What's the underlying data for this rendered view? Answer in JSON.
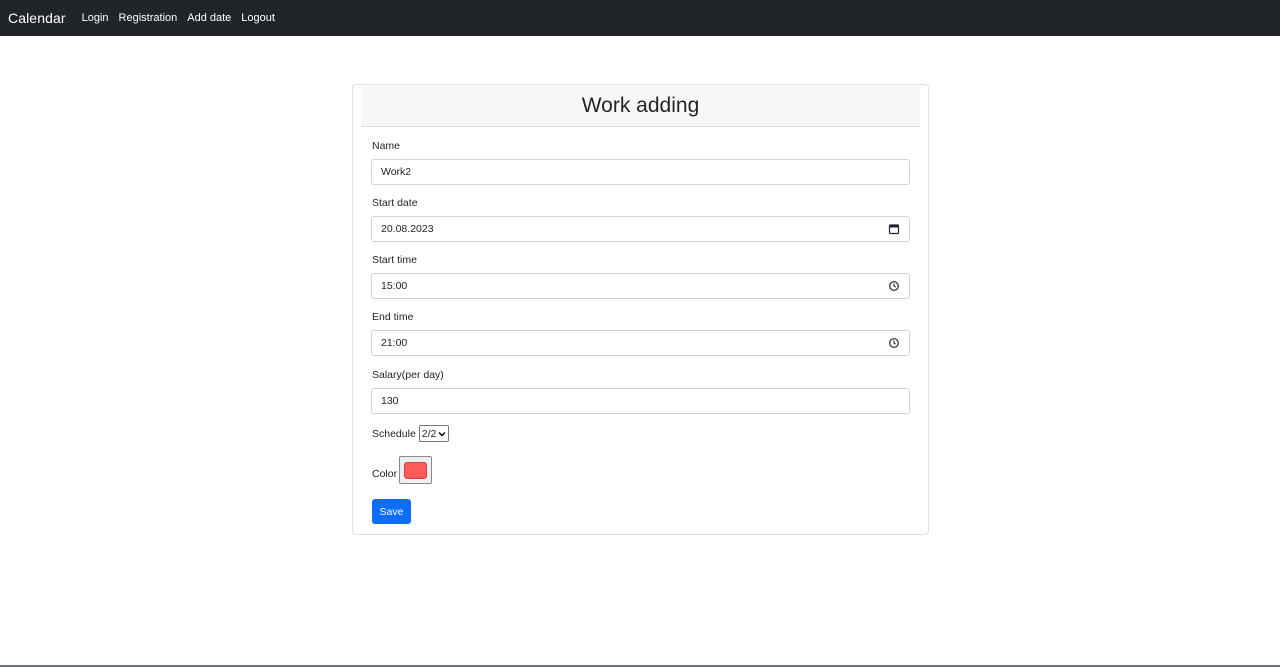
{
  "navbar": {
    "brand": "Calendar",
    "links": [
      "Login",
      "Registration",
      "Add date",
      "Logout"
    ]
  },
  "form": {
    "title": "Work adding",
    "name": {
      "label": "Name",
      "value": "Work2"
    },
    "start_date": {
      "label": "Start date",
      "value": "20.08.2023",
      "icon": "calendar-icon"
    },
    "start_time": {
      "label": "Start time",
      "value": "15:00",
      "icon": "clock-icon"
    },
    "end_time": {
      "label": "End time",
      "value": "21:00",
      "icon": "clock-icon"
    },
    "salary": {
      "label": "Salary(per day)",
      "value": "130"
    },
    "schedule": {
      "label": "Schedule",
      "selected": "2/2"
    },
    "color": {
      "label": "Color",
      "value": "#ff5a5a"
    },
    "save_label": "Save"
  },
  "colors": {
    "navbar_bg": "#212529",
    "primary": "#0d6efd"
  }
}
